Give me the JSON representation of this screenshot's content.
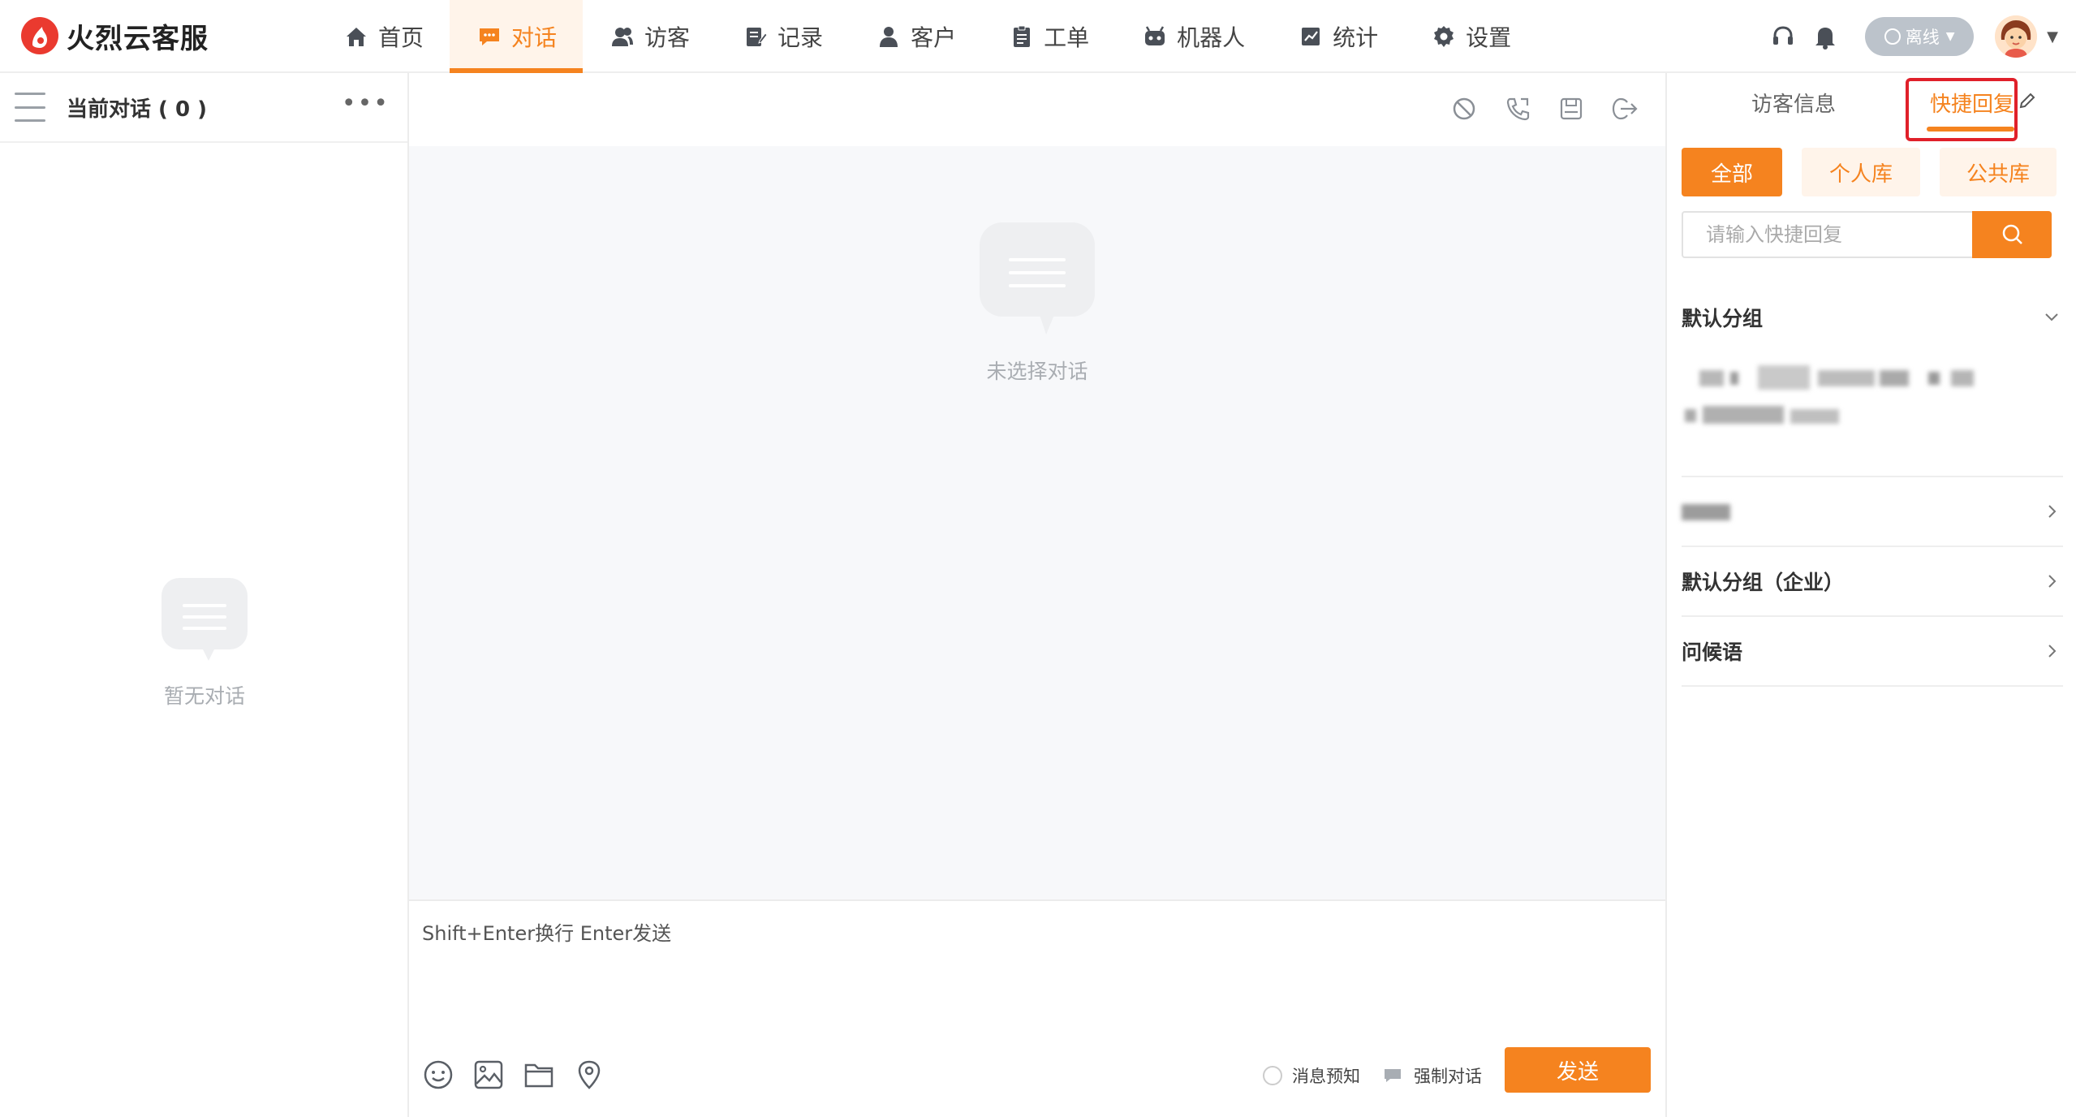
{
  "app": {
    "brand_name": "火烈云客服"
  },
  "nav": {
    "items": [
      {
        "label": "首页",
        "icon": "home-icon"
      },
      {
        "label": "对话",
        "icon": "chat-icon",
        "active": true
      },
      {
        "label": "访客",
        "icon": "visitors-icon"
      },
      {
        "label": "记录",
        "icon": "records-icon"
      },
      {
        "label": "客户",
        "icon": "customer-icon"
      },
      {
        "label": "工单",
        "icon": "ticket-icon"
      },
      {
        "label": "机器人",
        "icon": "robot-icon"
      },
      {
        "label": "统计",
        "icon": "stats-icon"
      },
      {
        "label": "设置",
        "icon": "settings-icon"
      }
    ]
  },
  "topright": {
    "status_label": "离线",
    "status_color": "#bcc3cb"
  },
  "left": {
    "title": "当前对话 ( 0 )",
    "empty_text": "暂无对话"
  },
  "center": {
    "empty_text": "未选择对话",
    "composer_hint": "Shift+Enter换行 Enter发送",
    "option_preview": "消息预知",
    "option_force": "强制对话",
    "send_label": "发送"
  },
  "right": {
    "tab_visitor": "访客信息",
    "tab_quick": "快捷回复",
    "filters": [
      "全部",
      "个人库",
      "公共库"
    ],
    "search_placeholder": "请输入快捷回复",
    "groups": [
      {
        "title": "默认分组",
        "expanded": true
      },
      {
        "title": "默认分组（企业）",
        "expanded": false
      },
      {
        "title": "问候语",
        "expanded": false
      }
    ]
  },
  "colors": {
    "accent": "#f5831f",
    "accent_light": "#fff4ea",
    "highlight_box": "#e0202a",
    "brand_red": "#ea3a2f"
  }
}
